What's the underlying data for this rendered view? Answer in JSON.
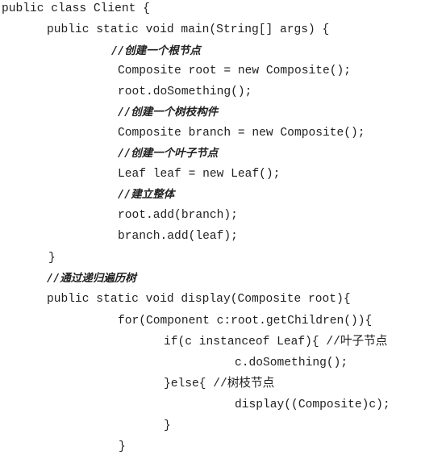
{
  "code": {
    "lines": [
      "public class Client {",
      "public static void main(String[] args) {",
      "//创建一个根节点",
      "Composite root = new Composite();",
      "root.doSomething();",
      "//创建一个树枝构件",
      "Composite branch = new Composite();",
      "//创建一个叶子节点",
      "Leaf leaf = new Leaf();",
      "//建立整体",
      "root.add(branch);",
      "branch.add(leaf);",
      "}",
      "//通过递归遍历树",
      "public static void display(Composite root){",
      "for(Component c:root.getChildren()){",
      "if(c instanceof Leaf){ //叶子节点",
      "c.doSomething();",
      "}else{ //树枝节点",
      "display((Composite)c);",
      "}",
      "}"
    ]
  }
}
